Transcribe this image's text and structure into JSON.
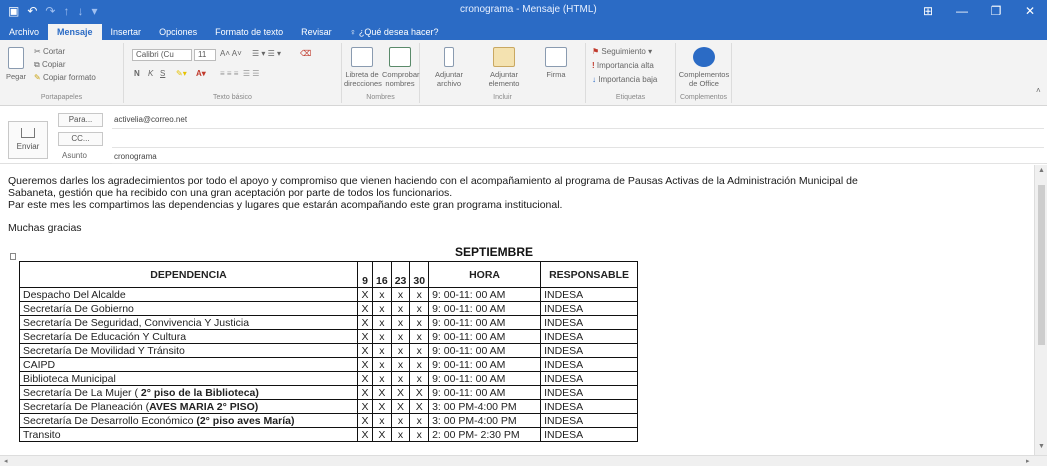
{
  "window": {
    "title": "cronograma - Mensaje (HTML)",
    "controls": [
      "⊞",
      "—",
      "❐",
      "✕"
    ]
  },
  "tabs": [
    {
      "label": "Archivo",
      "active": false
    },
    {
      "label": "Mensaje",
      "active": true
    },
    {
      "label": "Insertar",
      "active": false
    },
    {
      "label": "Opciones",
      "active": false
    },
    {
      "label": "Formato de texto",
      "active": false
    },
    {
      "label": "Revisar",
      "active": false
    }
  ],
  "tell_me": "¿Qué desea hacer?",
  "ribbon": {
    "portapapeles": {
      "pegar": "Pegar",
      "cortar": "Cortar",
      "copiar": "Copiar",
      "copiar_formato": "Copiar formato",
      "label": "Portapapeles"
    },
    "texto_basico": {
      "font": "Calibri (Cu",
      "size": "11",
      "label": "Texto básico"
    },
    "nombres": {
      "libreta": "Libreta de direcciones",
      "comprobar": "Comprobar nombres",
      "label": "Nombres"
    },
    "incluir": {
      "adjuntar_archivo": "Adjuntar archivo",
      "adjuntar_elemento": "Adjuntar elemento",
      "firma": "Firma",
      "label": "Incluir"
    },
    "etiquetas": {
      "seguimiento": "Seguimiento",
      "alta": "Importancia alta",
      "baja": "Importancia baja",
      "label": "Etiquetas"
    },
    "complementos": {
      "office": "Complementos de Office",
      "label": "Complementos"
    }
  },
  "header": {
    "send_label": "Enviar",
    "to_label": "Para...",
    "to_value": "activelia@correo.net",
    "cc_label": "CC...",
    "subject_label": "Asunto",
    "subject_value": "cronograma"
  },
  "body": {
    "p1_line1": "Queremos darles los agradecimientos  por todo el apoyo y compromiso que vienen haciendo con el acompañamiento al programa de Pausas Activas de la Administración Municipal de",
    "p1_line2": "Sabaneta, gestión que ha recibido con una gran aceptación por parte de todos los funcionarios.",
    "p2": "Par este mes les compartimos las dependencias y lugares que estarán acompañando este gran programa institucional.",
    "thanks": "Muchas gracias",
    "month": "SEPTIEMBRE"
  },
  "table": {
    "headers": {
      "dependencia": "DEPENDENCIA",
      "d9": "9",
      "d16": "16",
      "d23": "23",
      "d30": "30",
      "hora": "HORA",
      "responsable": "RESPONSABLE"
    },
    "rows": [
      {
        "dep": "Despacho Del Alcalde",
        "depb": "",
        "m": [
          "X",
          "x",
          "x",
          "x"
        ],
        "hora": "9: 00-11: 00 AM",
        "resp": "INDESA"
      },
      {
        "dep": "Secretaría De Gobierno",
        "depb": "",
        "m": [
          "X",
          "x",
          "x",
          "x"
        ],
        "hora": "9: 00-11: 00 AM",
        "resp": "INDESA"
      },
      {
        "dep": "Secretaría De Seguridad, Convivencia Y Justicia",
        "depb": "",
        "m": [
          "X",
          "x",
          "x",
          "x"
        ],
        "hora": "9: 00-11: 00 AM",
        "resp": "INDESA"
      },
      {
        "dep": "Secretaría De Educación Y Cultura",
        "depb": "",
        "m": [
          "X",
          "x",
          "x",
          "x"
        ],
        "hora": "9: 00-11: 00 AM",
        "resp": "INDESA"
      },
      {
        "dep": "Secretaría De Movilidad Y Tránsito",
        "depb": "",
        "m": [
          "X",
          "x",
          "x",
          "x"
        ],
        "hora": "9: 00-11: 00 AM",
        "resp": "INDESA"
      },
      {
        "dep": "CAIPD",
        "depb": "",
        "m": [
          "X",
          "x",
          "x",
          "x"
        ],
        "hora": "9: 00-11: 00 AM",
        "resp": "INDESA"
      },
      {
        "dep": "Biblioteca Municipal",
        "depb": "",
        "m": [
          "X",
          "x",
          "x",
          "x"
        ],
        "hora": "9: 00-11: 00 AM",
        "resp": "INDESA"
      },
      {
        "dep": "Secretaría De La Mujer ( ",
        "depb": "2° piso de la Biblioteca)",
        "m": [
          "X",
          "X",
          "X",
          "X"
        ],
        "hora": "9: 00-11: 00 AM",
        "resp": "INDESA"
      },
      {
        "dep": "Secretaría De Planeación (",
        "depb": "AVES MARIA 2° PISO)",
        "m": [
          "X",
          "X",
          "X",
          "X"
        ],
        "hora": "3: 00 PM-4:00 PM",
        "resp": "INDESA"
      },
      {
        "dep": "Secretaría De Desarrollo Económico ",
        "depb": "(2° piso aves María)",
        "m": [
          "X",
          "x",
          "x",
          "x"
        ],
        "hora": "3: 00 PM-4:00 PM",
        "resp": "INDESA"
      },
      {
        "dep": "Transito",
        "depb": "",
        "m": [
          "X",
          "X",
          "x",
          "x"
        ],
        "hora": "2: 00 PM- 2:30 PM",
        "resp": "INDESA"
      }
    ]
  }
}
